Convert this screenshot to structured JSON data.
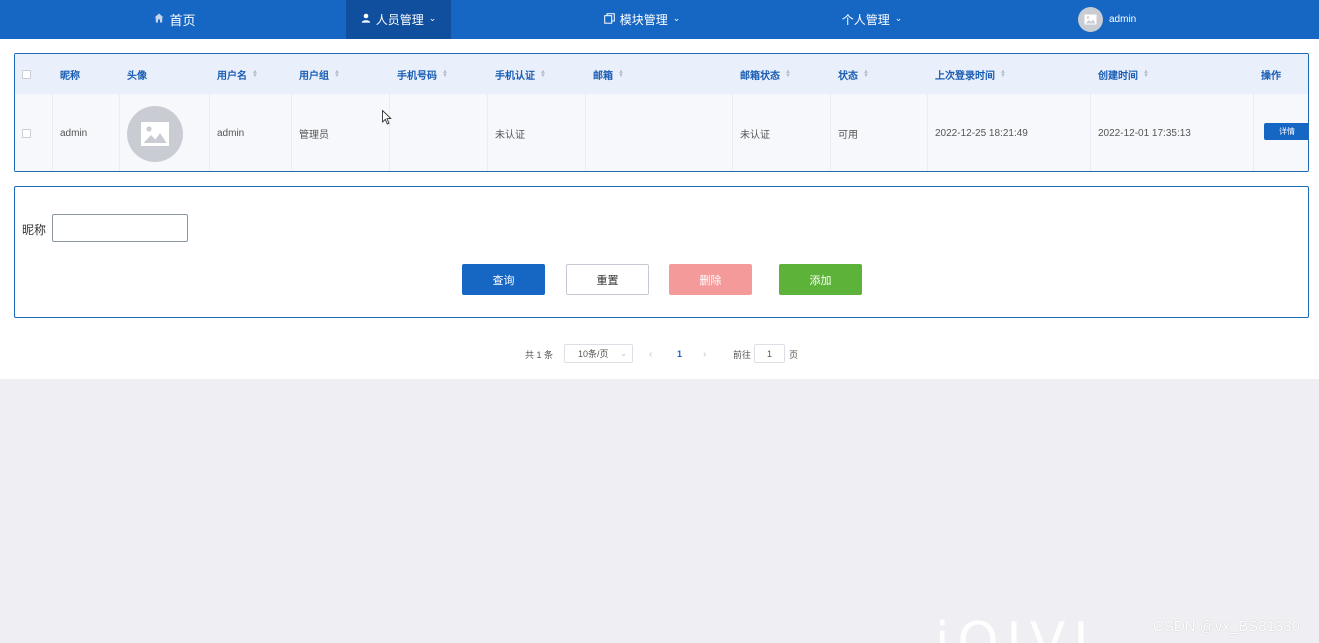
{
  "nav": {
    "home": "首页",
    "users": "人员管理",
    "modules": "模块管理",
    "personal": "个人管理",
    "username": "admin"
  },
  "table": {
    "columns": [
      "昵称",
      "头像",
      "用户名",
      "用户组",
      "手机号码",
      "手机认证",
      "邮箱",
      "邮箱状态",
      "状态",
      "上次登录时间",
      "创建时间",
      "操作"
    ],
    "rows": [
      {
        "nickname": "admin",
        "username": "admin",
        "group": "管理员",
        "phone": "",
        "phone_verified": "未认证",
        "email": "",
        "email_status": "未认证",
        "status": "可用",
        "last_login": "2022-12-25 18:21:49",
        "created": "2022-12-01 17:35:13",
        "action": "详情"
      }
    ]
  },
  "search": {
    "label": "昵称",
    "value": "",
    "query": "查询",
    "reset": "重置",
    "delete": "删除",
    "add": "添加"
  },
  "pager": {
    "total": "共 1 条",
    "page_size": "10条/页",
    "current": "1",
    "goto": "前往",
    "goto_value": "1",
    "page_suffix": "页"
  },
  "watermark": "CSDN @vx_BS81330"
}
